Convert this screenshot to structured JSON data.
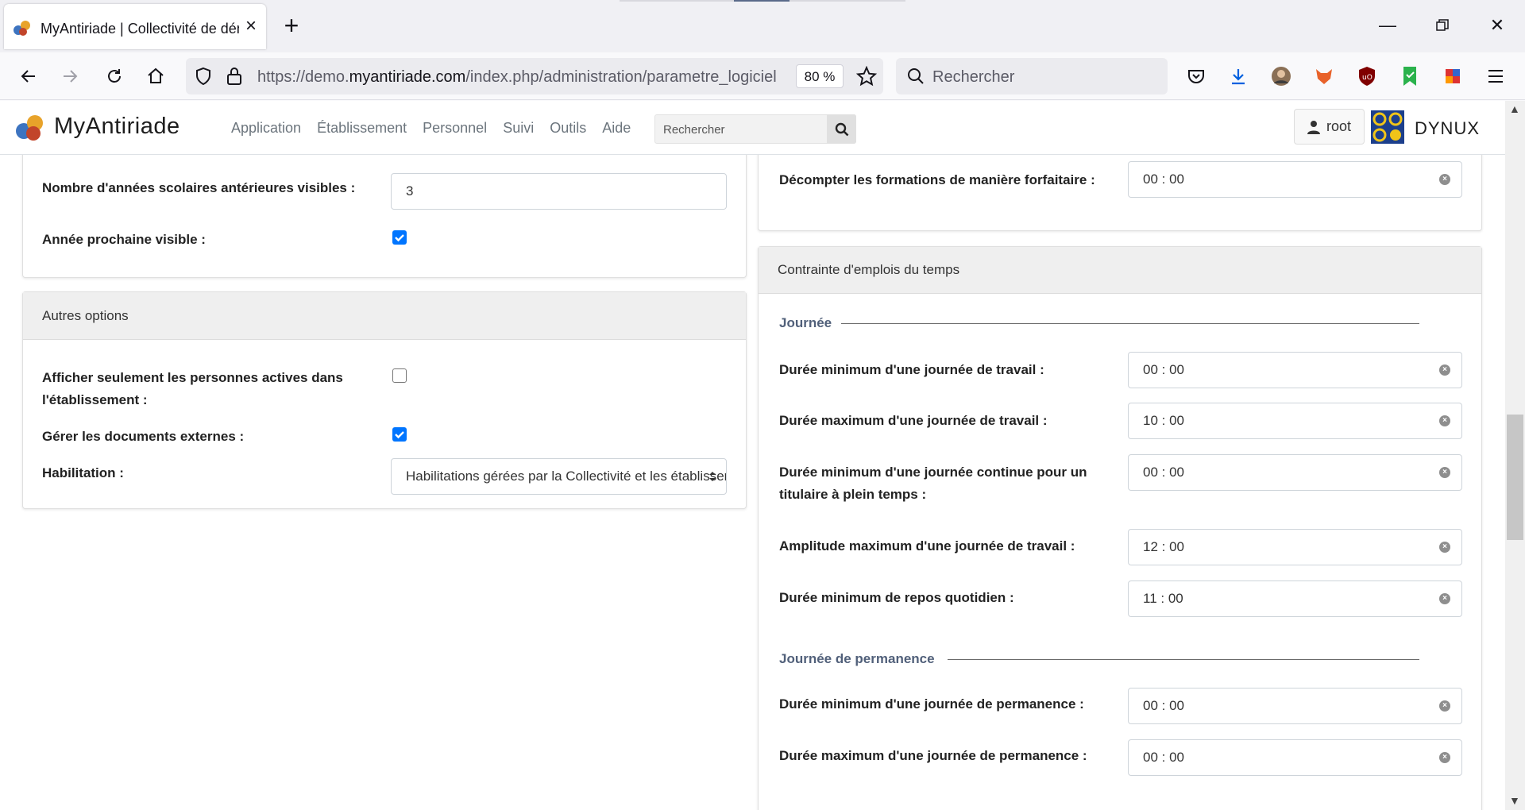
{
  "browser": {
    "tab_title": "MyAntiriade | Collectivité de démo",
    "url_prefix": "https://demo.",
    "url_domain": "myantiriade.com",
    "url_path": "/index.php/administration/parametre_logiciel",
    "zoom": "80 %",
    "search_placeholder": "Rechercher"
  },
  "app": {
    "logo_text": "MyAntiriade",
    "menu": [
      "Application",
      "Établissement",
      "Personnel",
      "Suivi",
      "Outils",
      "Aide"
    ],
    "search_placeholder": "Rechercher",
    "user": "root",
    "brand": "DYNUX"
  },
  "left_top_card": {
    "prev_years_label": "Nombre d'années scolaires antérieures visibles :",
    "prev_years_value": "3",
    "next_year_label": "Année prochaine visible :",
    "next_year_checked": true
  },
  "other_options": {
    "title": "Autres options",
    "active_only_label_1": "Afficher seulement les personnes actives dans",
    "active_only_label_2": "l'établissement :",
    "active_only_checked": false,
    "external_docs_label": "Gérer les documents externes :",
    "external_docs_checked": true,
    "habilitation_label": "Habilitation :",
    "habilitation_value": "Habilitations gérées par la Collectivité et les établissements"
  },
  "right_top_card": {
    "forfait_label": "Décompter les formations de manière forfaitaire :",
    "forfait_value": "00 : 00"
  },
  "timetable": {
    "title": "Contrainte d'emplois du temps",
    "section_day": "Journée",
    "min_day_label": "Durée minimum d'une journée de travail :",
    "min_day_value": "00 : 00",
    "max_day_label": "Durée maximum d'une journée de travail :",
    "max_day_value": "10 : 00",
    "min_continuous_label_1": "Durée minimum d'une journée continue pour un",
    "min_continuous_label_2": "titulaire à plein temps :",
    "min_continuous_value": "00 : 00",
    "amplitude_label": "Amplitude maximum d'une journée de travail :",
    "amplitude_value": "12 : 00",
    "rest_label": "Durée minimum de repos quotidien :",
    "rest_value": "11 : 00",
    "section_permanence": "Journée de permanence",
    "min_perm_label": "Durée minimum d'une journée de permanence :",
    "min_perm_value": "00 : 00",
    "max_perm_label": "Durée maximum d'une journée de permanence :",
    "max_perm_value": "00 : 00"
  },
  "colors": {
    "checkbox": "#0075ff",
    "section_title": "#51607a",
    "card_header": "#efefef"
  }
}
